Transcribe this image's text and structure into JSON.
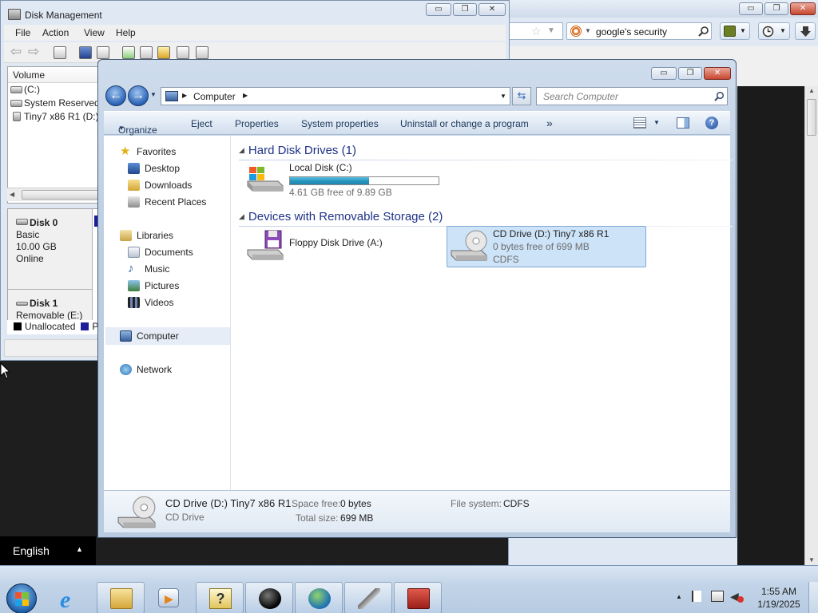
{
  "browser": {
    "search_text": "google's security",
    "min_glyph": "▭",
    "restore_glyph": "❐",
    "close_glyph": "✕",
    "search_icon": "search-icon",
    "feed_icon": "feed-icon",
    "history_icon": "history-icon",
    "download_icon": "download-icon"
  },
  "disk_mgmt": {
    "title": "Disk Management",
    "menu": [
      "File",
      "Action",
      "View",
      "Help"
    ],
    "volume_header": "Volume",
    "volumes": [
      "(C:)",
      "System Reserved",
      "Tiny7 x86 R1 (D:)"
    ],
    "disk0": {
      "name": "Disk 0",
      "type": "Basic",
      "size": "10.00 GB",
      "status": "Online"
    },
    "disk1": {
      "name": "Disk 1",
      "type": "Removable (E:)"
    },
    "legend": {
      "unallocated": "Unallocated",
      "primary": "P"
    }
  },
  "explorer": {
    "address": "Computer",
    "search_placeholder": "Search Computer",
    "commands": [
      "Organize",
      "Eject",
      "Properties",
      "System properties",
      "Uninstall or change a program",
      "»"
    ],
    "nav": {
      "favorites": "Favorites",
      "favorites_items": [
        "Desktop",
        "Downloads",
        "Recent Places"
      ],
      "libraries": "Libraries",
      "libraries_items": [
        "Documents",
        "Music",
        "Pictures",
        "Videos"
      ],
      "computer": "Computer",
      "network": "Network"
    },
    "groups": {
      "hdd": "Hard Disk Drives (1)",
      "removable": "Devices with Removable Storage (2)"
    },
    "drives": {
      "local": {
        "name": "Local Disk (C:)",
        "free": "4.61 GB free of 9.89 GB",
        "used_fraction": 0.534
      },
      "floppy": {
        "name": "Floppy Disk Drive (A:)"
      },
      "cd": {
        "name": "CD Drive (D:) Tiny7 x86 R1",
        "free": "0 bytes free of 699 MB",
        "fs": "CDFS"
      }
    },
    "details": {
      "name": "CD Drive (D:) Tiny7 x86 R1",
      "type": "CD Drive",
      "space_free_label": "Space free:",
      "space_free": "0 bytes",
      "total_label": "Total size:",
      "total": "699 MB",
      "fs_label": "File system:",
      "fs": "CDFS"
    }
  },
  "language": {
    "label": "English",
    "arrow": "▲"
  },
  "taskbar": {
    "time": "1:55 AM",
    "date": "1/19/2025",
    "apps": [
      "start-orb",
      "internet-explorer",
      "windows-explorer",
      "media-player",
      "help",
      "pool-ball",
      "download-manager",
      "rocket",
      "toolbox"
    ]
  },
  "colors": {
    "accent": "#2a63b7",
    "bar_fill": "#2694be",
    "selection": "#cde3f8"
  }
}
